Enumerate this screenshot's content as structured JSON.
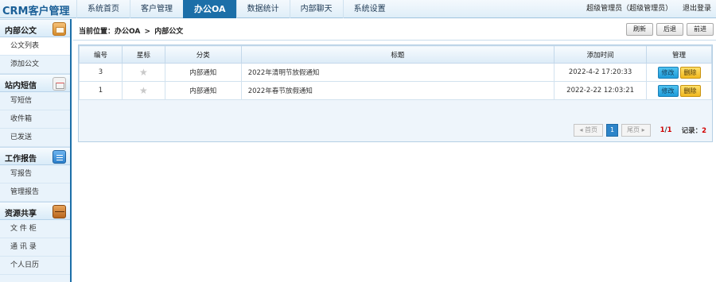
{
  "app": {
    "title": "CRM客户管理"
  },
  "nav": {
    "items": [
      {
        "label": "系统首页"
      },
      {
        "label": "客户管理"
      },
      {
        "label": "办公OA",
        "active": true
      },
      {
        "label": "数据统计"
      },
      {
        "label": "内部聊天"
      },
      {
        "label": "系统设置"
      }
    ]
  },
  "user": {
    "name": "超级管理员（超级管理员）",
    "logout": "退出登录"
  },
  "sidebar": {
    "groups": [
      {
        "title": "内部公文",
        "icon": "mail-icon",
        "items": [
          "公文列表",
          "添加公文"
        ]
      },
      {
        "title": "站内短信",
        "icon": "envelope-icon",
        "items": [
          "写短信",
          "收件箱",
          "已发送"
        ]
      },
      {
        "title": "工作报告",
        "icon": "document-icon",
        "items": [
          "写报告",
          "管理报告"
        ]
      },
      {
        "title": "资源共享",
        "icon": "box-icon",
        "items": [
          "文 件 柜",
          "通 讯 录",
          "个人日历"
        ]
      }
    ]
  },
  "breadcrumb": {
    "prefix": "当前位置：",
    "section": "办公OA",
    "sep": ">",
    "page": "内部公文"
  },
  "toolbar": {
    "refresh": "刷新",
    "back": "后退",
    "forward": "前进"
  },
  "table": {
    "headers": [
      "编号",
      "星标",
      "分类",
      "标题",
      "添加时间",
      "管理"
    ],
    "rows": [
      {
        "id": "3",
        "category": "内部通知",
        "title": "2022年清明节放假通知",
        "time": "2022-4-2 17:20:33",
        "edit": "修改",
        "delete": "删除"
      },
      {
        "id": "1",
        "category": "内部通知",
        "title": "2022年春节放假通知",
        "time": "2022-2-22 12:03:21",
        "edit": "修改",
        "delete": "删除"
      }
    ]
  },
  "pager": {
    "first": "首页",
    "current": "1",
    "last": "尾页",
    "page_cur": "1",
    "page_sep": "/",
    "page_total": "1",
    "records_label": "记录：",
    "records": "2"
  },
  "colors": {
    "primary": "#1c6fa8",
    "edit": "#1f9bd9",
    "delete": "#f1b81f",
    "accent_red": "#d20000"
  }
}
